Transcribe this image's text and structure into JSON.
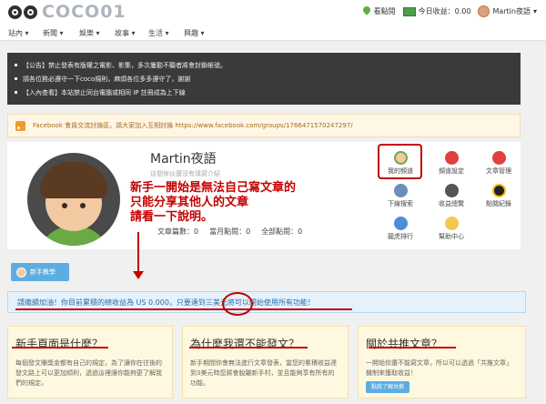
{
  "header": {
    "logo_text": "COCO01",
    "points_label": "看點閱",
    "earnings_label": "今日收益：0.00",
    "user_label": "Martin夜語"
  },
  "nav": {
    "items": [
      "站內",
      "新聞",
      "娛樂",
      "故事",
      "生活",
      "興趣"
    ]
  },
  "announcement": {
    "lines": [
      "【公告】禁止發表有版權之電影、影集，多次屢勸不聽者將會封鎖帳號。",
      "請各位務必遵守一下coco規則，麻煩各位多多遵守了，謝謝",
      "【入內查看】本站禁止同台電腦或相同 IP 註冊成為上下線"
    ]
  },
  "facebook": {
    "text": "Facebook 會員交流討論區，請大家加入互相討論 https://www.facebook.com/groups/1766471570247297/"
  },
  "profile": {
    "name": "Martin夜語",
    "intro": "這個傢伙還沒有填寫介紹",
    "stats": [
      "文章篇數：0",
      "當月點閱：0",
      "全部點閱：0"
    ],
    "menu": [
      {
        "label": "我的頻道",
        "icon": "user-icon"
      },
      {
        "label": "頻道設定",
        "icon": "settings-icon"
      },
      {
        "label": "文章管理",
        "icon": "edit-icon"
      },
      {
        "label": "下線搜索",
        "icon": "people-icon"
      },
      {
        "label": "收益總覽",
        "icon": "coins-icon"
      },
      {
        "label": "點閱紀錄",
        "icon": "eye-icon"
      },
      {
        "label": "龍虎排行",
        "icon": "ranking-icon"
      },
      {
        "label": "幫助中心",
        "icon": "help-icon"
      }
    ]
  },
  "annotation": {
    "lines": [
      "新手一開始是無法自己寫文章的",
      "只能分享其他人的文章",
      "請看一下說明。"
    ],
    "color": "#c40000"
  },
  "newbie_button": "新手教學",
  "info_bar": "請繼續加油！你目前累積的總收益為 US 0.000，只要達到三美元將可以開始使用所有功能！",
  "boxes": [
    {
      "title": "新手頁面是什麼？",
      "body": "每個發文賺獎金都有自己的規定，為了讓你在往後的發文路上可以更加順利，透過這裡讓你能夠更了解我們的規定。"
    },
    {
      "title": "為什麼我還不能發文？",
      "body": "新手期間你會無法進行文章發表，當您的累積收益達到3美元時您將會脫離新手村，並且能夠享有所有的功能。"
    },
    {
      "title": "關於共推文章？",
      "body": "一開始你還不能寫文章，所以可以透過「共推文章」機制來獲取收益！",
      "button": "點我了解共推"
    }
  ]
}
